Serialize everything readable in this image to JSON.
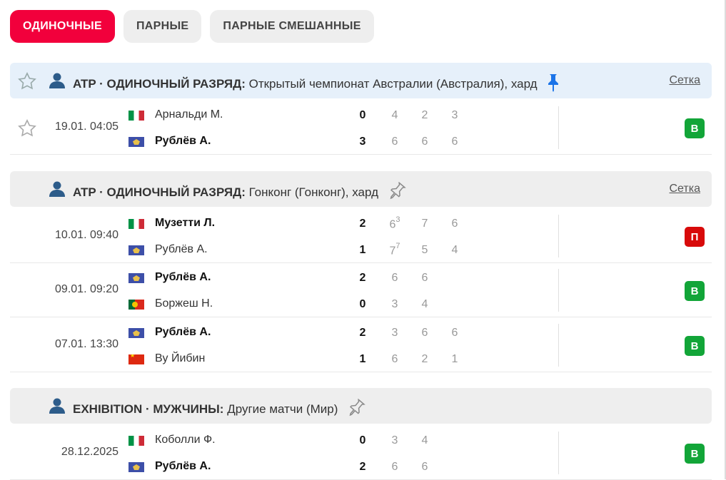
{
  "tabs": [
    {
      "label": "ОДИНОЧНЫЕ",
      "active": true
    },
    {
      "label": "ПАРНЫЕ",
      "active": false
    },
    {
      "label": "ПАРНЫЕ СМЕШАННЫЕ",
      "active": false
    }
  ],
  "colors": {
    "accent": "#f2003c",
    "win": "#12a538",
    "loss": "#d80a0a",
    "pin_active": "#1a73e8"
  },
  "sections": [
    {
      "prefix": "ATP · ОДИНОЧНЫЙ РАЗРЯД:",
      "name": "Открытый чемпионат Австралии (Австралия), хард",
      "bracket": "Сетка",
      "pinned": true,
      "matches": [
        {
          "time": "19.01. 04:05",
          "p1": {
            "name": "Арнальди М.",
            "flag": "italy-flag",
            "score": "0",
            "sets": [
              "4",
              "2",
              "3"
            ],
            "tb": [
              "",
              "",
              ""
            ],
            "winner": false
          },
          "p2": {
            "name": "Рублёв А.",
            "flag": "neutral-flag",
            "score": "3",
            "sets": [
              "6",
              "6",
              "6"
            ],
            "tb": [
              "",
              "",
              ""
            ],
            "winner": true
          },
          "result": "В"
        }
      ]
    },
    {
      "prefix": "ATP · ОДИНОЧНЫЙ РАЗРЯД:",
      "name": "Гонконг (Гонконг), хард",
      "bracket": "Сетка",
      "pinned": false,
      "matches": [
        {
          "time": "10.01. 09:40",
          "p1": {
            "name": "Музетти Л.",
            "flag": "italy-flag",
            "score": "2",
            "sets": [
              "6",
              "7",
              "6"
            ],
            "tb": [
              "3",
              "",
              ""
            ],
            "winner": true
          },
          "p2": {
            "name": "Рублёв А.",
            "flag": "neutral-flag",
            "score": "1",
            "sets": [
              "7",
              "5",
              "4"
            ],
            "tb": [
              "7",
              "",
              ""
            ],
            "winner": false
          },
          "result": "П"
        },
        {
          "time": "09.01. 09:20",
          "p1": {
            "name": "Рублёв А.",
            "flag": "neutral-flag",
            "score": "2",
            "sets": [
              "6",
              "6"
            ],
            "tb": [
              "",
              ""
            ],
            "winner": true
          },
          "p2": {
            "name": "Боржеш Н.",
            "flag": "portugal-flag",
            "score": "0",
            "sets": [
              "3",
              "4"
            ],
            "tb": [
              "",
              ""
            ],
            "winner": false
          },
          "result": "В"
        },
        {
          "time": "07.01. 13:30",
          "p1": {
            "name": "Рублёв А.",
            "flag": "neutral-flag",
            "score": "2",
            "sets": [
              "3",
              "6",
              "6"
            ],
            "tb": [
              "",
              "",
              ""
            ],
            "winner": true
          },
          "p2": {
            "name": "Ву Йибин",
            "flag": "china-flag",
            "score": "1",
            "sets": [
              "6",
              "2",
              "1"
            ],
            "tb": [
              "",
              "",
              ""
            ],
            "winner": false
          },
          "result": "В"
        }
      ]
    },
    {
      "prefix": "EXHIBITION · МУЖЧИНЫ:",
      "name": "Другие матчи (Мир)",
      "bracket": "",
      "pinned": false,
      "matches": [
        {
          "time": "28.12.2025",
          "p1": {
            "name": "Коболли Ф.",
            "flag": "italy-flag",
            "score": "0",
            "sets": [
              "3",
              "4"
            ],
            "tb": [
              "",
              ""
            ],
            "winner": false
          },
          "p2": {
            "name": "Рублёв А.",
            "flag": "neutral-flag",
            "score": "2",
            "sets": [
              "6",
              "6"
            ],
            "tb": [
              "",
              ""
            ],
            "winner": true
          },
          "result": "В"
        }
      ]
    }
  ]
}
